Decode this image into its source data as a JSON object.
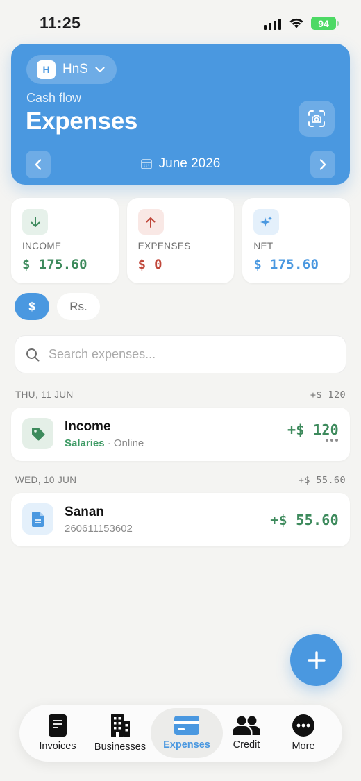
{
  "status_bar": {
    "time": "11:25",
    "battery": "94"
  },
  "header": {
    "business": {
      "initial": "H",
      "name": "HnS"
    },
    "kicker": "Cash flow",
    "title": "Expenses",
    "month": "June 2026"
  },
  "summary": [
    {
      "label": "INCOME",
      "value": "$ 175.60",
      "color": "#3d8a5c"
    },
    {
      "label": "EXPENSES",
      "value": "$ 0",
      "color": "#c0473a"
    },
    {
      "label": "NET",
      "value": "$ 175.60",
      "color": "#4a98e0"
    }
  ],
  "currency_chips": [
    "$",
    "Rs."
  ],
  "search": {
    "placeholder": "Search expenses..."
  },
  "days": [
    {
      "date": "THU, 11 JUN",
      "total": "+$ 120",
      "transactions": [
        {
          "title": "Income",
          "category": "Salaries",
          "separator": "·",
          "method": "Online",
          "amount": "+$ 120",
          "icon": "tag-icon"
        }
      ]
    },
    {
      "date": "WED, 10 JUN",
      "total": "+$ 55.60",
      "transactions": [
        {
          "title": "Sanan",
          "reference": "260611153602",
          "amount": "+$ 55.60",
          "icon": "document-icon"
        }
      ]
    }
  ],
  "tabbar": [
    {
      "label": "Invoices",
      "icon": "invoice-icon"
    },
    {
      "label": "Businesses",
      "icon": "building-icon"
    },
    {
      "label": "Expenses",
      "icon": "card-icon",
      "active": true
    },
    {
      "label": "Credit",
      "icon": "people-icon"
    },
    {
      "label": "More",
      "icon": "more-icon"
    }
  ],
  "colors": {
    "accent": "#4a98e0",
    "income": "#3d8a5c",
    "expense": "#c0473a",
    "background": "#f4f4f2"
  }
}
